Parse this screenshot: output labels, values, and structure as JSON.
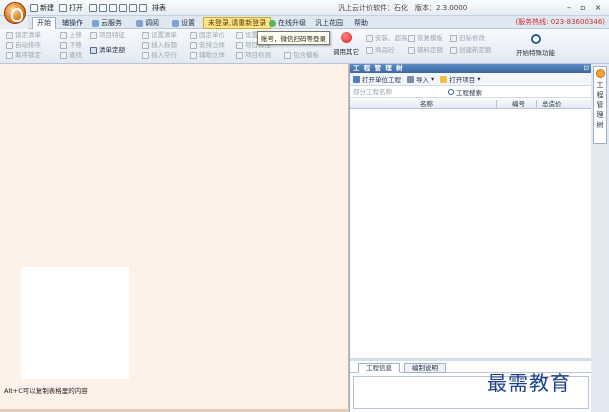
{
  "titlebar": {
    "quick_access": [
      "新建",
      "打开",
      "排表"
    ],
    "title": "汎上云计价软件：石化　版本：2.3.0000",
    "minimize": "–",
    "maximize": "▫",
    "close": "×"
  },
  "menu": {
    "tabs": [
      "开始",
      "辅操作",
      "云服务",
      "调阅",
      "设置",
      "未登录,请重新登录",
      "在线升级",
      "汎上花园",
      "帮助"
    ],
    "active_tab": "开始",
    "hotline": "(服务热线: 023-83600346)"
  },
  "ribbon": {
    "col1": [
      "锁定清单",
      "自动排序",
      "筹序锁定"
    ],
    "col2": [
      "上移",
      "下移",
      "查找"
    ],
    "col3": [
      "项目特征",
      "清单定额"
    ],
    "col4": [
      "设置清单",
      "插入标题",
      "插入空行"
    ],
    "col5": [
      "固定单价",
      "安排立体",
      "辅助立体"
    ],
    "col6": [
      "设置",
      "项目标注",
      "项目检测"
    ],
    "col6_extra": "包含模板",
    "tooltip": "账号，微信扫码等登录",
    "big_left": "调用其它",
    "right_row1": [
      "安装、超高",
      "恢复模板",
      "旧标修改"
    ],
    "right_row2": [
      "商品砼",
      "钢料定额",
      "创建新定额"
    ],
    "big_right": "开始特殊功能"
  },
  "workspace": {
    "status_text": "Alt+C可以复制表格里的内容"
  },
  "panel": {
    "title": "工 程 管 理 树",
    "pin": "⊡",
    "open_unit": "打开单位工程",
    "import": "导入",
    "open_project": "打开项目",
    "search_placeholder": "部分工程名称",
    "search_button": "工程搜索",
    "columns": [
      "名称",
      "编号",
      "总造价"
    ],
    "bottom_tabs": [
      "工程信息",
      "编制说明"
    ]
  },
  "sidetab": {
    "label": "工程管理树"
  },
  "watermark": "最需教育",
  "colors": {
    "accent": "#3b67a3",
    "workspace_bg": "#fdf1ea",
    "hotline": "#d12d2d",
    "notice": "#ffe58a"
  }
}
